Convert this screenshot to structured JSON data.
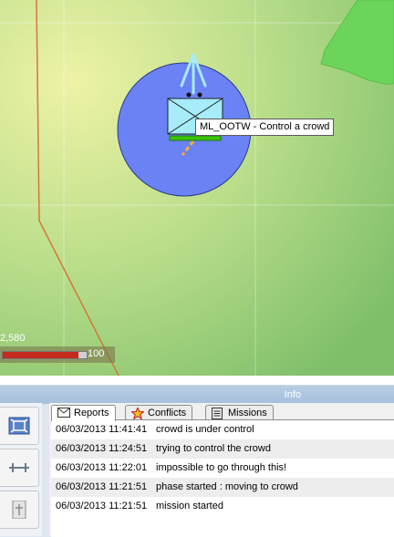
{
  "map": {
    "unit_tooltip": "ML_OOTW - Control a crowd",
    "scale_label": "2,580",
    "status_value": "100",
    "status_fraction": 0.9
  },
  "info_panel": {
    "title": "Info"
  },
  "tabs": [
    {
      "label": "Reports",
      "icon": "envelope-icon",
      "active": true
    },
    {
      "label": "Conflicts",
      "icon": "star-icon",
      "active": false
    },
    {
      "label": "Missions",
      "icon": "document-icon",
      "active": false
    }
  ],
  "reports": [
    {
      "time": "06/03/2013 11:41:41",
      "message": "crowd is under control"
    },
    {
      "time": "06/03/2013 11:24:51",
      "message": "trying to control the crowd"
    },
    {
      "time": "06/03/2013 11:22:01",
      "message": "impossible to go through this!"
    },
    {
      "time": "06/03/2013 11:21:51",
      "message": "phase started : moving to crowd"
    },
    {
      "time": "06/03/2013 11:21:51",
      "message": "mission started"
    }
  ],
  "colors": {
    "circle": "#6a82f4",
    "forest": "#6cd45a",
    "unit_fill": "#a6ecfb",
    "route": "#d2783a",
    "header": "#a6bfdc"
  }
}
